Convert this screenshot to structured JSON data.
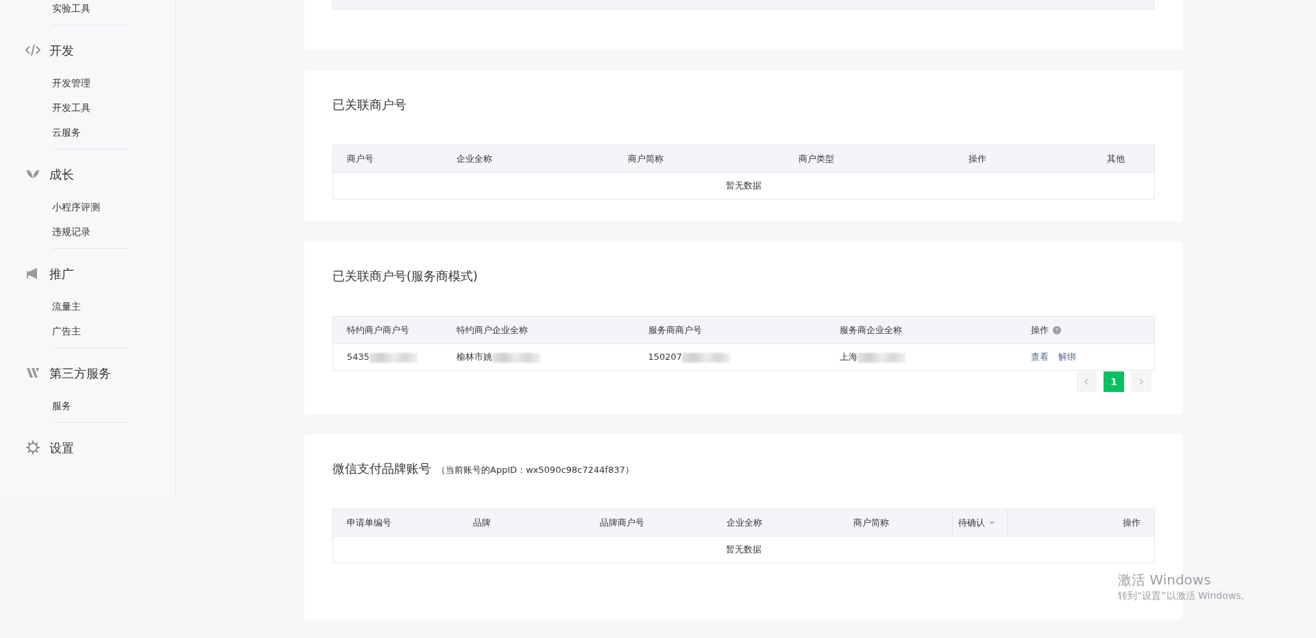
{
  "sidebar": {
    "groups": [
      {
        "items": [
          {
            "label": "实验工具"
          }
        ]
      },
      {
        "title": "开发",
        "items": [
          {
            "label": "开发管理"
          },
          {
            "label": "开发工具"
          },
          {
            "label": "云服务"
          }
        ]
      },
      {
        "title": "成长",
        "items": [
          {
            "label": "小程序评测"
          },
          {
            "label": "违规记录"
          }
        ]
      },
      {
        "title": "推广",
        "items": [
          {
            "label": "流量主"
          },
          {
            "label": "广告主"
          }
        ]
      },
      {
        "title": "第三方服务",
        "items": [
          {
            "label": "服务"
          }
        ]
      },
      {
        "title": "设置"
      }
    ]
  },
  "sections": [
    {
      "title": "已关联商户号",
      "columns": [
        {
          "label": "商户号",
          "kind": "text"
        },
        {
          "label": "企业全称",
          "kind": "text"
        },
        {
          "label": "商户简称",
          "kind": "text"
        },
        {
          "label": "商户类型",
          "kind": "text"
        },
        {
          "label": "操作",
          "kind": "text"
        },
        {
          "label": "其他",
          "kind": "text"
        }
      ],
      "empty_text": "暂无数据"
    },
    {
      "title": "已关联商户号(服务商模式)",
      "columns": [
        {
          "label": "特约商户商户号",
          "kind": "text"
        },
        {
          "label": "特约商户企业全称",
          "kind": "text"
        },
        {
          "label": "服务商商户号",
          "kind": "text"
        },
        {
          "label": "服务商企业全称",
          "kind": "text"
        },
        {
          "label": "操作",
          "kind": "help"
        }
      ],
      "rows": [
        {
          "cells": [
            {
              "text": "5435",
              "redacted": true
            },
            {
              "text": "榆林市姚",
              "redacted": true
            },
            {
              "text": "150207",
              "redacted": true
            },
            {
              "text": "上海",
              "redacted": true
            }
          ],
          "actions": [
            {
              "label": "查看"
            },
            {
              "label": "解绑"
            }
          ]
        }
      ],
      "pagination": {
        "prev": {
          "disabled": true
        },
        "pages": [
          {
            "label": "1",
            "selected": true
          }
        ],
        "next": {
          "disabled": true
        }
      }
    },
    {
      "title": "微信支付品牌账号",
      "subtitle": "（当前账号的AppID：wx5090c98c7244f837）",
      "columns": [
        {
          "label": "申请单编号",
          "kind": "text"
        },
        {
          "label": "品牌",
          "kind": "text"
        },
        {
          "label": "品牌商户号",
          "kind": "text"
        },
        {
          "label": "企业全称",
          "kind": "text"
        },
        {
          "label": "商户简称",
          "kind": "text"
        },
        {
          "label": "待确认",
          "kind": "dropdown"
        },
        {
          "label": "操作",
          "kind": "end"
        }
      ],
      "empty_text": "暂无数据"
    }
  ],
  "windows_activation": {
    "title": "激活 Windows",
    "hint": "转到“设置”以激活 Windows。"
  }
}
